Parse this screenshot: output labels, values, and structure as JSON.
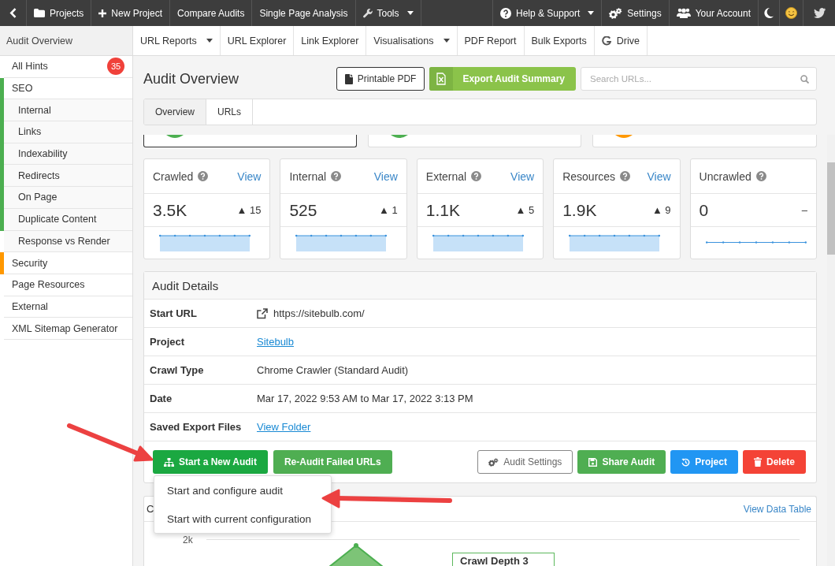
{
  "top_bar": {
    "left": [
      {
        "label": "Projects",
        "dropdown": false
      },
      {
        "label": "New Project",
        "dropdown": false
      },
      {
        "label": "Compare Audits",
        "dropdown": false
      },
      {
        "label": "Single Page Analysis",
        "dropdown": false
      },
      {
        "label": "Tools",
        "dropdown": true
      }
    ],
    "right": [
      {
        "label": "Help & Support",
        "dropdown": true
      },
      {
        "label": "Settings",
        "dropdown": false
      },
      {
        "label": "Your Account",
        "dropdown": false
      }
    ]
  },
  "nav": {
    "section": "Audit Overview",
    "tabs": [
      {
        "label": "URL Reports",
        "kind": "menu"
      },
      {
        "label": "URL Explorer",
        "kind": "plain"
      },
      {
        "label": "Link Explorer",
        "kind": "plain"
      },
      {
        "label": "Visualisations",
        "kind": "menu"
      },
      {
        "label": "PDF Report",
        "kind": "plain"
      },
      {
        "label": "Bulk Exports",
        "kind": "plain"
      },
      {
        "label": "Drive",
        "kind": "icon"
      }
    ]
  },
  "sidebar": {
    "items": [
      {
        "label": "All Hints",
        "badge": "35"
      },
      {
        "label": "SEO",
        "color": "#4caf50",
        "children": [
          {
            "label": "Internal",
            "color": "#4caf50"
          },
          {
            "label": "Links",
            "color": "#4caf50"
          },
          {
            "label": "Indexability",
            "color": "#4caf50"
          },
          {
            "label": "Redirects",
            "color": "#4caf50"
          },
          {
            "label": "On Page",
            "color": "#4caf50"
          },
          {
            "label": "Duplicate Content",
            "color": "#4caf50"
          },
          {
            "label": "Response vs Render"
          }
        ]
      },
      {
        "label": "Security",
        "color": "#ff9800"
      },
      {
        "label": "Page Resources"
      },
      {
        "label": "External"
      },
      {
        "label": "XML Sitemap Generator"
      }
    ]
  },
  "header": {
    "title": "Audit Overview",
    "pdf_button": "Printable PDF",
    "export_button": "Export Audit Summary",
    "search": {
      "placeholder": "Search URLs..."
    }
  },
  "tabs": [
    {
      "label": "Overview",
      "selected": true
    },
    {
      "label": "URLs",
      "selected": false
    }
  ],
  "partial_cards": [
    {
      "selected": true,
      "color": "#4caf50"
    },
    {
      "selected": false,
      "color": "#4caf50"
    },
    {
      "selected": false,
      "color": "#ff9800"
    }
  ],
  "stats": [
    {
      "label": "Crawled",
      "link": "View",
      "value": "3.5K",
      "change": "▲ 15",
      "kind": "area"
    },
    {
      "label": "Internal",
      "link": "View",
      "value": "525",
      "change": "▲ 1",
      "kind": "area"
    },
    {
      "label": "External",
      "link": "View",
      "value": "1.1K",
      "change": "▲ 5",
      "kind": "area"
    },
    {
      "label": "Resources",
      "link": "View",
      "value": "1.9K",
      "change": "▲ 9",
      "kind": "area"
    },
    {
      "label": "Uncrawled",
      "value": "0",
      "change": "–",
      "kind": "line"
    }
  ],
  "audit_details": {
    "title": "Audit Details",
    "rows": [
      {
        "label": "Start URL",
        "value": "https://sitebulb.com/",
        "kind": "external"
      },
      {
        "label": "Project",
        "value": "Sitebulb",
        "kind": "link"
      },
      {
        "label": "Crawl Type",
        "value": "Chrome Crawler (Standard Audit)",
        "kind": "text"
      },
      {
        "label": "Date",
        "value": "Mar 17, 2022 9:53 AM to Mar 17, 2022 3:13 PM",
        "kind": "text"
      },
      {
        "label": "Saved Export Files",
        "value": "View Folder",
        "kind": "link"
      }
    ],
    "actions_left": [
      {
        "label": "Start a New Audit",
        "kind": "primary"
      },
      {
        "label": "Re-Audit Failed URLs",
        "kind": "success"
      }
    ],
    "actions_right": [
      {
        "label": "Audit Settings",
        "kind": "default"
      },
      {
        "label": "Share Audit",
        "kind": "success"
      },
      {
        "label": "Project",
        "kind": "info"
      },
      {
        "label": "Delete",
        "kind": "danger"
      }
    ],
    "start_menu": {
      "open": true,
      "items": [
        "Start and configure audit",
        "Start with current configuration"
      ]
    }
  },
  "chart_panel": {
    "title": "C",
    "link": "View Data Table",
    "y_tick": "2k",
    "tooltip": "Crawl Depth 3"
  }
}
